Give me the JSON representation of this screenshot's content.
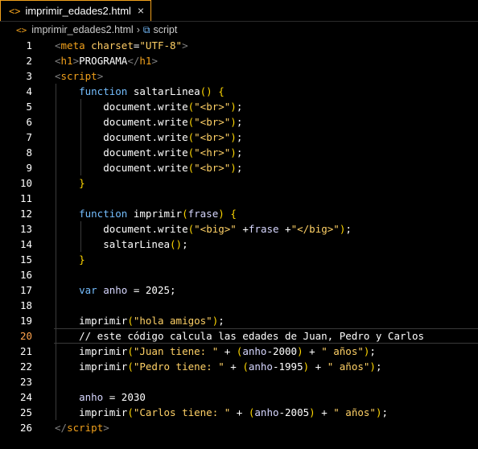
{
  "tab": {
    "title": "imprimir_edades2.html",
    "close": "×",
    "icon": "<>"
  },
  "breadcrumb": {
    "file": "imprimir_edades2.html",
    "separator": "›",
    "symbol_icon": "⧉",
    "symbol": "script"
  },
  "current_line": 20,
  "lines": [
    {
      "n": "1",
      "tokens": [
        [
          "brk",
          "<"
        ],
        [
          "tag",
          "meta"
        ],
        [
          "txt",
          " "
        ],
        [
          "attr",
          "charset"
        ],
        [
          "txt",
          "="
        ],
        [
          "str",
          "\"UTF-8\""
        ],
        [
          "brk",
          ">"
        ]
      ]
    },
    {
      "n": "2",
      "tokens": [
        [
          "brk",
          "<"
        ],
        [
          "tag",
          "h1"
        ],
        [
          "brk",
          ">"
        ],
        [
          "txt",
          "PROGRAMA"
        ],
        [
          "brk",
          "</"
        ],
        [
          "tag",
          "h1"
        ],
        [
          "brk",
          ">"
        ]
      ]
    },
    {
      "n": "3",
      "tokens": [
        [
          "brk",
          "<"
        ],
        [
          "tag",
          "script"
        ],
        [
          "brk",
          ">"
        ]
      ]
    },
    {
      "n": "4",
      "tokens": [
        [
          "txt",
          "    "
        ],
        [
          "kw",
          "function"
        ],
        [
          "txt",
          " "
        ],
        [
          "fn",
          "saltarLinea"
        ],
        [
          "punc",
          "()"
        ],
        [
          "txt",
          " "
        ],
        [
          "punc",
          "{"
        ]
      ]
    },
    {
      "n": "5",
      "tokens": [
        [
          "txt",
          "        "
        ],
        [
          "obj",
          "document"
        ],
        [
          "txt",
          "."
        ],
        [
          "fn",
          "write"
        ],
        [
          "punc",
          "("
        ],
        [
          "str",
          "\"<br>\""
        ],
        [
          "punc",
          ")"
        ],
        [
          "txt",
          ";"
        ]
      ]
    },
    {
      "n": "6",
      "tokens": [
        [
          "txt",
          "        "
        ],
        [
          "obj",
          "document"
        ],
        [
          "txt",
          "."
        ],
        [
          "fn",
          "write"
        ],
        [
          "punc",
          "("
        ],
        [
          "str",
          "\"<br>\""
        ],
        [
          "punc",
          ")"
        ],
        [
          "txt",
          ";"
        ]
      ]
    },
    {
      "n": "7",
      "tokens": [
        [
          "txt",
          "        "
        ],
        [
          "obj",
          "document"
        ],
        [
          "txt",
          "."
        ],
        [
          "fn",
          "write"
        ],
        [
          "punc",
          "("
        ],
        [
          "str",
          "\"<br>\""
        ],
        [
          "punc",
          ")"
        ],
        [
          "txt",
          ";"
        ]
      ]
    },
    {
      "n": "8",
      "tokens": [
        [
          "txt",
          "        "
        ],
        [
          "obj",
          "document"
        ],
        [
          "txt",
          "."
        ],
        [
          "fn",
          "write"
        ],
        [
          "punc",
          "("
        ],
        [
          "str",
          "\"<hr>\""
        ],
        [
          "punc",
          ")"
        ],
        [
          "txt",
          ";"
        ]
      ]
    },
    {
      "n": "9",
      "tokens": [
        [
          "txt",
          "        "
        ],
        [
          "obj",
          "document"
        ],
        [
          "txt",
          "."
        ],
        [
          "fn",
          "write"
        ],
        [
          "punc",
          "("
        ],
        [
          "str",
          "\"<br>\""
        ],
        [
          "punc",
          ")"
        ],
        [
          "txt",
          ";"
        ]
      ]
    },
    {
      "n": "10",
      "tokens": [
        [
          "txt",
          "    "
        ],
        [
          "punc",
          "}"
        ]
      ]
    },
    {
      "n": "11",
      "tokens": []
    },
    {
      "n": "12",
      "tokens": [
        [
          "txt",
          "    "
        ],
        [
          "kw",
          "function"
        ],
        [
          "txt",
          " "
        ],
        [
          "fn",
          "imprimir"
        ],
        [
          "punc",
          "("
        ],
        [
          "var",
          "frase"
        ],
        [
          "punc",
          ")"
        ],
        [
          "txt",
          " "
        ],
        [
          "punc",
          "{"
        ]
      ]
    },
    {
      "n": "13",
      "tokens": [
        [
          "txt",
          "        "
        ],
        [
          "obj",
          "document"
        ],
        [
          "txt",
          "."
        ],
        [
          "fn",
          "write"
        ],
        [
          "punc",
          "("
        ],
        [
          "str",
          "\"<big>\""
        ],
        [
          "txt",
          " +"
        ],
        [
          "var",
          "frase"
        ],
        [
          "txt",
          " +"
        ],
        [
          "str",
          "\"</big>\""
        ],
        [
          "punc",
          ")"
        ],
        [
          "txt",
          ";"
        ]
      ]
    },
    {
      "n": "14",
      "tokens": [
        [
          "txt",
          "        "
        ],
        [
          "fn",
          "saltarLinea"
        ],
        [
          "punc",
          "()"
        ],
        [
          "txt",
          ";"
        ]
      ]
    },
    {
      "n": "15",
      "tokens": [
        [
          "txt",
          "    "
        ],
        [
          "punc",
          "}"
        ]
      ]
    },
    {
      "n": "16",
      "tokens": []
    },
    {
      "n": "17",
      "tokens": [
        [
          "txt",
          "    "
        ],
        [
          "kw",
          "var"
        ],
        [
          "txt",
          " "
        ],
        [
          "var",
          "anho"
        ],
        [
          "txt",
          " = "
        ],
        [
          "num",
          "2025"
        ],
        [
          "txt",
          ";"
        ]
      ]
    },
    {
      "n": "18",
      "tokens": []
    },
    {
      "n": "19",
      "tokens": [
        [
          "txt",
          "    "
        ],
        [
          "fn",
          "imprimir"
        ],
        [
          "punc",
          "("
        ],
        [
          "str",
          "\"hola amigos\""
        ],
        [
          "punc",
          ")"
        ],
        [
          "txt",
          ";"
        ]
      ]
    },
    {
      "n": "20",
      "tokens": [
        [
          "txt",
          "    "
        ],
        [
          "cmt",
          "// este código calcula las edades de Juan, Pedro y Carlos"
        ]
      ]
    },
    {
      "n": "21",
      "tokens": [
        [
          "txt",
          "    "
        ],
        [
          "fn",
          "imprimir"
        ],
        [
          "punc",
          "("
        ],
        [
          "str",
          "\"Juan tiene: \""
        ],
        [
          "txt",
          " + "
        ],
        [
          "punc",
          "("
        ],
        [
          "var",
          "anho"
        ],
        [
          "txt",
          "-"
        ],
        [
          "num",
          "2000"
        ],
        [
          "punc",
          ")"
        ],
        [
          "txt",
          " + "
        ],
        [
          "str",
          "\" años\""
        ],
        [
          "punc",
          ")"
        ],
        [
          "txt",
          ";"
        ]
      ]
    },
    {
      "n": "22",
      "tokens": [
        [
          "txt",
          "    "
        ],
        [
          "fn",
          "imprimir"
        ],
        [
          "punc",
          "("
        ],
        [
          "str",
          "\"Pedro tiene: \""
        ],
        [
          "txt",
          " + "
        ],
        [
          "punc",
          "("
        ],
        [
          "var",
          "anho"
        ],
        [
          "txt",
          "-"
        ],
        [
          "num",
          "1995"
        ],
        [
          "punc",
          ")"
        ],
        [
          "txt",
          " + "
        ],
        [
          "str",
          "\" años\""
        ],
        [
          "punc",
          ")"
        ],
        [
          "txt",
          ";"
        ]
      ]
    },
    {
      "n": "23",
      "tokens": []
    },
    {
      "n": "24",
      "tokens": [
        [
          "txt",
          "    "
        ],
        [
          "var",
          "anho"
        ],
        [
          "txt",
          " = "
        ],
        [
          "num",
          "2030"
        ]
      ]
    },
    {
      "n": "25",
      "tokens": [
        [
          "txt",
          "    "
        ],
        [
          "fn",
          "imprimir"
        ],
        [
          "punc",
          "("
        ],
        [
          "str",
          "\"Carlos tiene: \""
        ],
        [
          "txt",
          " + "
        ],
        [
          "punc",
          "("
        ],
        [
          "var",
          "anho"
        ],
        [
          "txt",
          "-"
        ],
        [
          "num",
          "2005"
        ],
        [
          "punc",
          ")"
        ],
        [
          "txt",
          " + "
        ],
        [
          "str",
          "\" años\""
        ],
        [
          "punc",
          ")"
        ],
        [
          "txt",
          ";"
        ]
      ]
    },
    {
      "n": "26",
      "tokens": [
        [
          "brk",
          "</"
        ],
        [
          "tag",
          "script"
        ],
        [
          "brk",
          ">"
        ]
      ]
    }
  ]
}
